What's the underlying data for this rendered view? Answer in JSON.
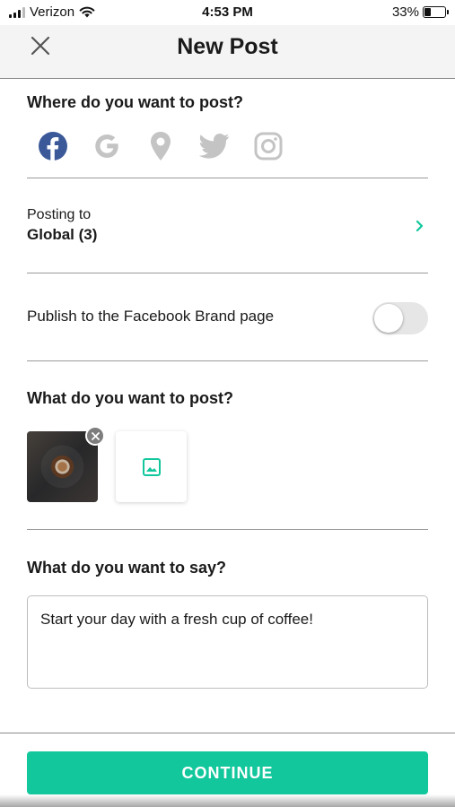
{
  "status_bar": {
    "carrier": "Verizon",
    "time": "4:53 PM",
    "battery": "33%",
    "battery_level": 0.33
  },
  "header": {
    "title": "New Post",
    "close_icon": "close-icon"
  },
  "where": {
    "heading": "Where do you want to post?",
    "platforms": [
      {
        "name": "facebook",
        "icon": "facebook-icon",
        "selected": true
      },
      {
        "name": "google",
        "icon": "google-icon",
        "selected": false
      },
      {
        "name": "location",
        "icon": "location-pin-icon",
        "selected": false
      },
      {
        "name": "twitter",
        "icon": "twitter-icon",
        "selected": false
      },
      {
        "name": "instagram",
        "icon": "instagram-icon",
        "selected": false
      }
    ]
  },
  "posting": {
    "label": "Posting to",
    "value": "Global (3)"
  },
  "publish": {
    "label": "Publish to the Facebook Brand page",
    "enabled": false
  },
  "what_post": {
    "heading": "What do you want to post?"
  },
  "what_say": {
    "heading": "What do you want to say?",
    "message": "Start your day with a fresh cup of coffee!"
  },
  "footer": {
    "continue_label": "CONTINUE"
  },
  "colors": {
    "accent": "#12c79c",
    "facebook": "#3b5998",
    "inactive_icon": "#c4c4c4"
  }
}
